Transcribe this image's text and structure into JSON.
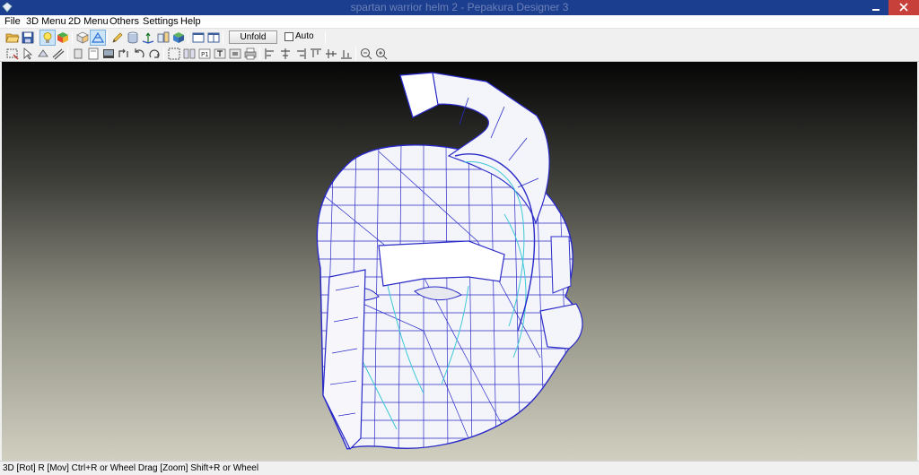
{
  "window": {
    "title": "spartan warrior helm 2 - Pepakura Designer 3"
  },
  "menubar": {
    "items": [
      "File",
      "3D Menu",
      "2D Menu",
      "Others",
      "Settings",
      "Help"
    ]
  },
  "toolbar": {
    "unfold_label": "Unfold",
    "auto_label": "Auto",
    "auto_checked": false
  },
  "status": {
    "text": "3D [Rot] R [Mov] Ctrl+R or Wheel Drag [Zoom] Shift+R or Wheel"
  },
  "colors": {
    "titlebar": "#1c3e8f",
    "close_button": "#c7413a",
    "model_edges": "#2a2ac8",
    "fold_lines": "#3cc8d8",
    "model_faces": "#f4f5fa"
  }
}
